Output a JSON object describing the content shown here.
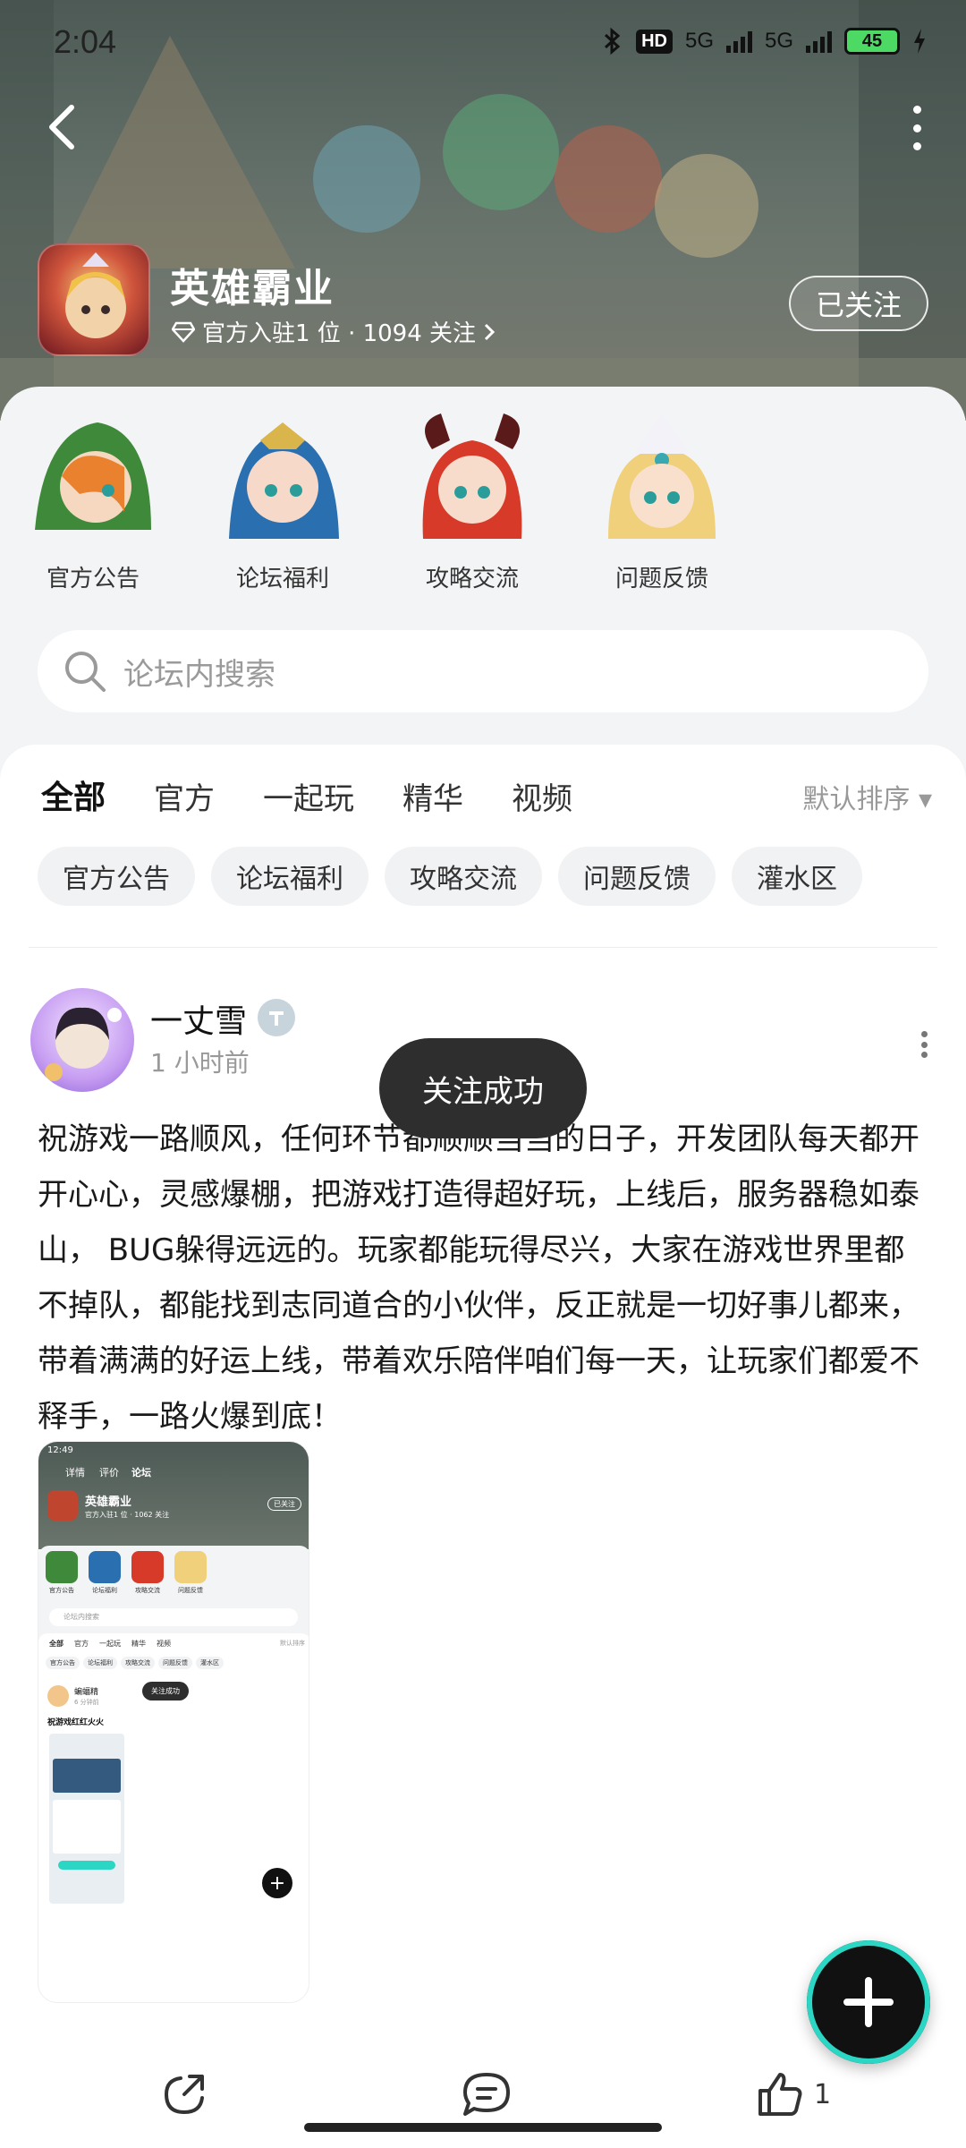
{
  "status_bar": {
    "time": "2:04",
    "hd_label": "HD",
    "net1": "5G",
    "net2": "5G",
    "battery": "45"
  },
  "header": {
    "game_title": "英雄霸业",
    "meta": "官方入驻1 位 · 1094 关注",
    "follow_label": "已关注"
  },
  "categories": [
    {
      "label": "官方公告"
    },
    {
      "label": "论坛福利"
    },
    {
      "label": "攻略交流"
    },
    {
      "label": "问题反馈"
    }
  ],
  "search": {
    "placeholder": "论坛内搜索"
  },
  "tabs": [
    {
      "label": "全部",
      "active": true
    },
    {
      "label": "官方"
    },
    {
      "label": "一起玩"
    },
    {
      "label": "精华"
    },
    {
      "label": "视频"
    }
  ],
  "sort_label": "默认排序",
  "chips": [
    "官方公告",
    "论坛福利",
    "攻略交流",
    "问题反馈",
    "灌水区"
  ],
  "post": {
    "author": "一丈雪",
    "time": "1 小时前",
    "body": "祝游戏一路顺风，任何环节都顺顺当当的日子，开发团队每天都开开心心，灵感爆棚，把游戏打造得超好玩，上线后，服务器稳如泰山， BUG躲得远远的。玩家都能玩得尽兴，大家在游戏世界里都不掉队，都能找到志同道合的小伙伴，反正就是一切好事儿都来，带着满满的好运上线，带着欢乐陪伴咱们每一天，让玩家们都爱不释手，一路火爆到底！"
  },
  "toast": "关注成功",
  "thumbnail": {
    "time": "12:49",
    "tabs": [
      "详情",
      "评价",
      "论坛"
    ],
    "game_title": "英雄霸业",
    "meta": "官方入驻1 位 · 1062 关注",
    "follow_label": "已关注",
    "categories": [
      "官方公告",
      "论坛福利",
      "攻略交流",
      "问题反馈"
    ],
    "search_placeholder": "论坛内搜索",
    "tabs2": [
      "全部",
      "官方",
      "一起玩",
      "精华",
      "视频"
    ],
    "sort_label": "默认排序",
    "chips": [
      "官方公告",
      "论坛福利",
      "攻略交流",
      "问题反馈",
      "灌水区"
    ],
    "author": "蝙蝠精",
    "post_time": "6 分钟前",
    "toast": "关注成功",
    "post_title": "祝游戏红红火火"
  },
  "bottom_bar": {
    "like_count": "1"
  },
  "colors": {
    "accent": "#27d6c2",
    "toast_bg": "#2e2e2e"
  }
}
